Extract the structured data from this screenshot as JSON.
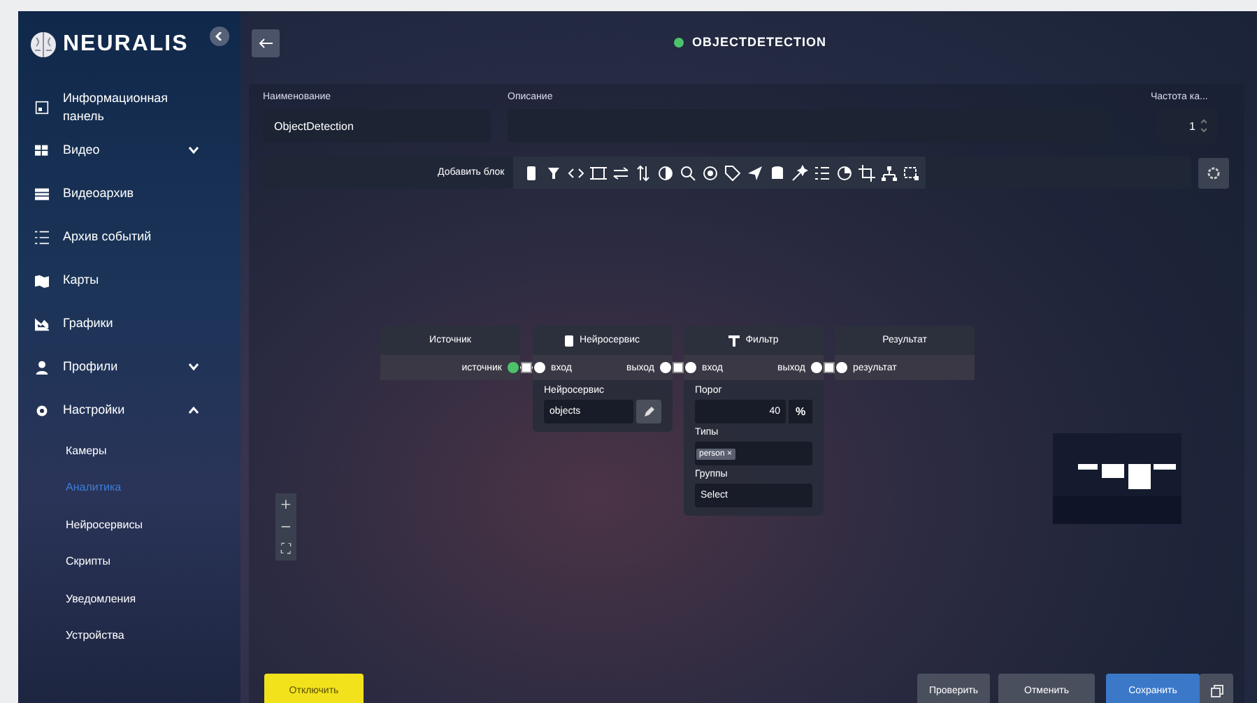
{
  "sidebar": {
    "logo": "NEURALIS",
    "items": [
      {
        "label": "Информационная панель",
        "selected": false
      },
      {
        "label": "Видео",
        "selected": false,
        "expanded": false
      },
      {
        "label": "Видеоархив",
        "selected": false
      },
      {
        "label": "Архив событий",
        "selected": false
      },
      {
        "label": "Карты",
        "selected": false
      },
      {
        "label": "Графики",
        "selected": false
      },
      {
        "label": "Профили",
        "selected": false,
        "expanded": false
      },
      {
        "label": "Настройки",
        "selected": false,
        "expanded": true,
        "children": [
          {
            "label": "Камеры",
            "selected": false
          },
          {
            "label": "Аналитика",
            "selected": true
          },
          {
            "label": "Нейросервисы",
            "selected": false
          },
          {
            "label": "Скрипты",
            "selected": false
          },
          {
            "label": "Уведомления",
            "selected": false
          },
          {
            "label": "Устройства",
            "selected": false
          }
        ]
      }
    ]
  },
  "header": {
    "title": "OBJECTDETECTION",
    "active": true
  },
  "form": {
    "name_label": "Наименование",
    "name_value": "ObjectDetection",
    "description_label": "Описание",
    "frequency_label": "Частота ка...",
    "frequency_value": "1"
  },
  "toolbar": {
    "add_block_label": "Добавить блок"
  },
  "nodes": [
    {
      "title": "Источник",
      "kind": "source",
      "outputs": [
        {
          "label": "источник",
          "color": "#4cc36b"
        }
      ]
    },
    {
      "title": "Нейросервис",
      "kind": "neuro",
      "inputs": [
        {
          "label": "вход"
        }
      ],
      "outputs": [
        {
          "label": "выход",
          "color": "#ffffff"
        }
      ],
      "fields": [
        {
          "kind": "edit",
          "label": "Нейросервис",
          "value": "objects"
        }
      ]
    },
    {
      "title": "Фильтр",
      "kind": "filter",
      "inputs": [
        {
          "label": "вход"
        }
      ],
      "outputs": [
        {
          "label": "выход",
          "color": "#ffffff"
        }
      ],
      "fields": [
        {
          "kind": "number",
          "label": "Порог",
          "value": "40",
          "unit": "%"
        },
        {
          "kind": "tags",
          "label": "Типы",
          "tags": [
            "person ×"
          ]
        },
        {
          "kind": "select",
          "label": "Группы",
          "value": "Select"
        }
      ]
    },
    {
      "title": "Результат",
      "kind": "result",
      "inputs": [
        {
          "label": "результат"
        }
      ]
    }
  ],
  "zoom_controls": [
    "+",
    "−",
    "⛶"
  ],
  "footer": {
    "disable": "Отключить",
    "check": "Проверить",
    "cancel": "Отменить",
    "save": "Сохранить"
  }
}
